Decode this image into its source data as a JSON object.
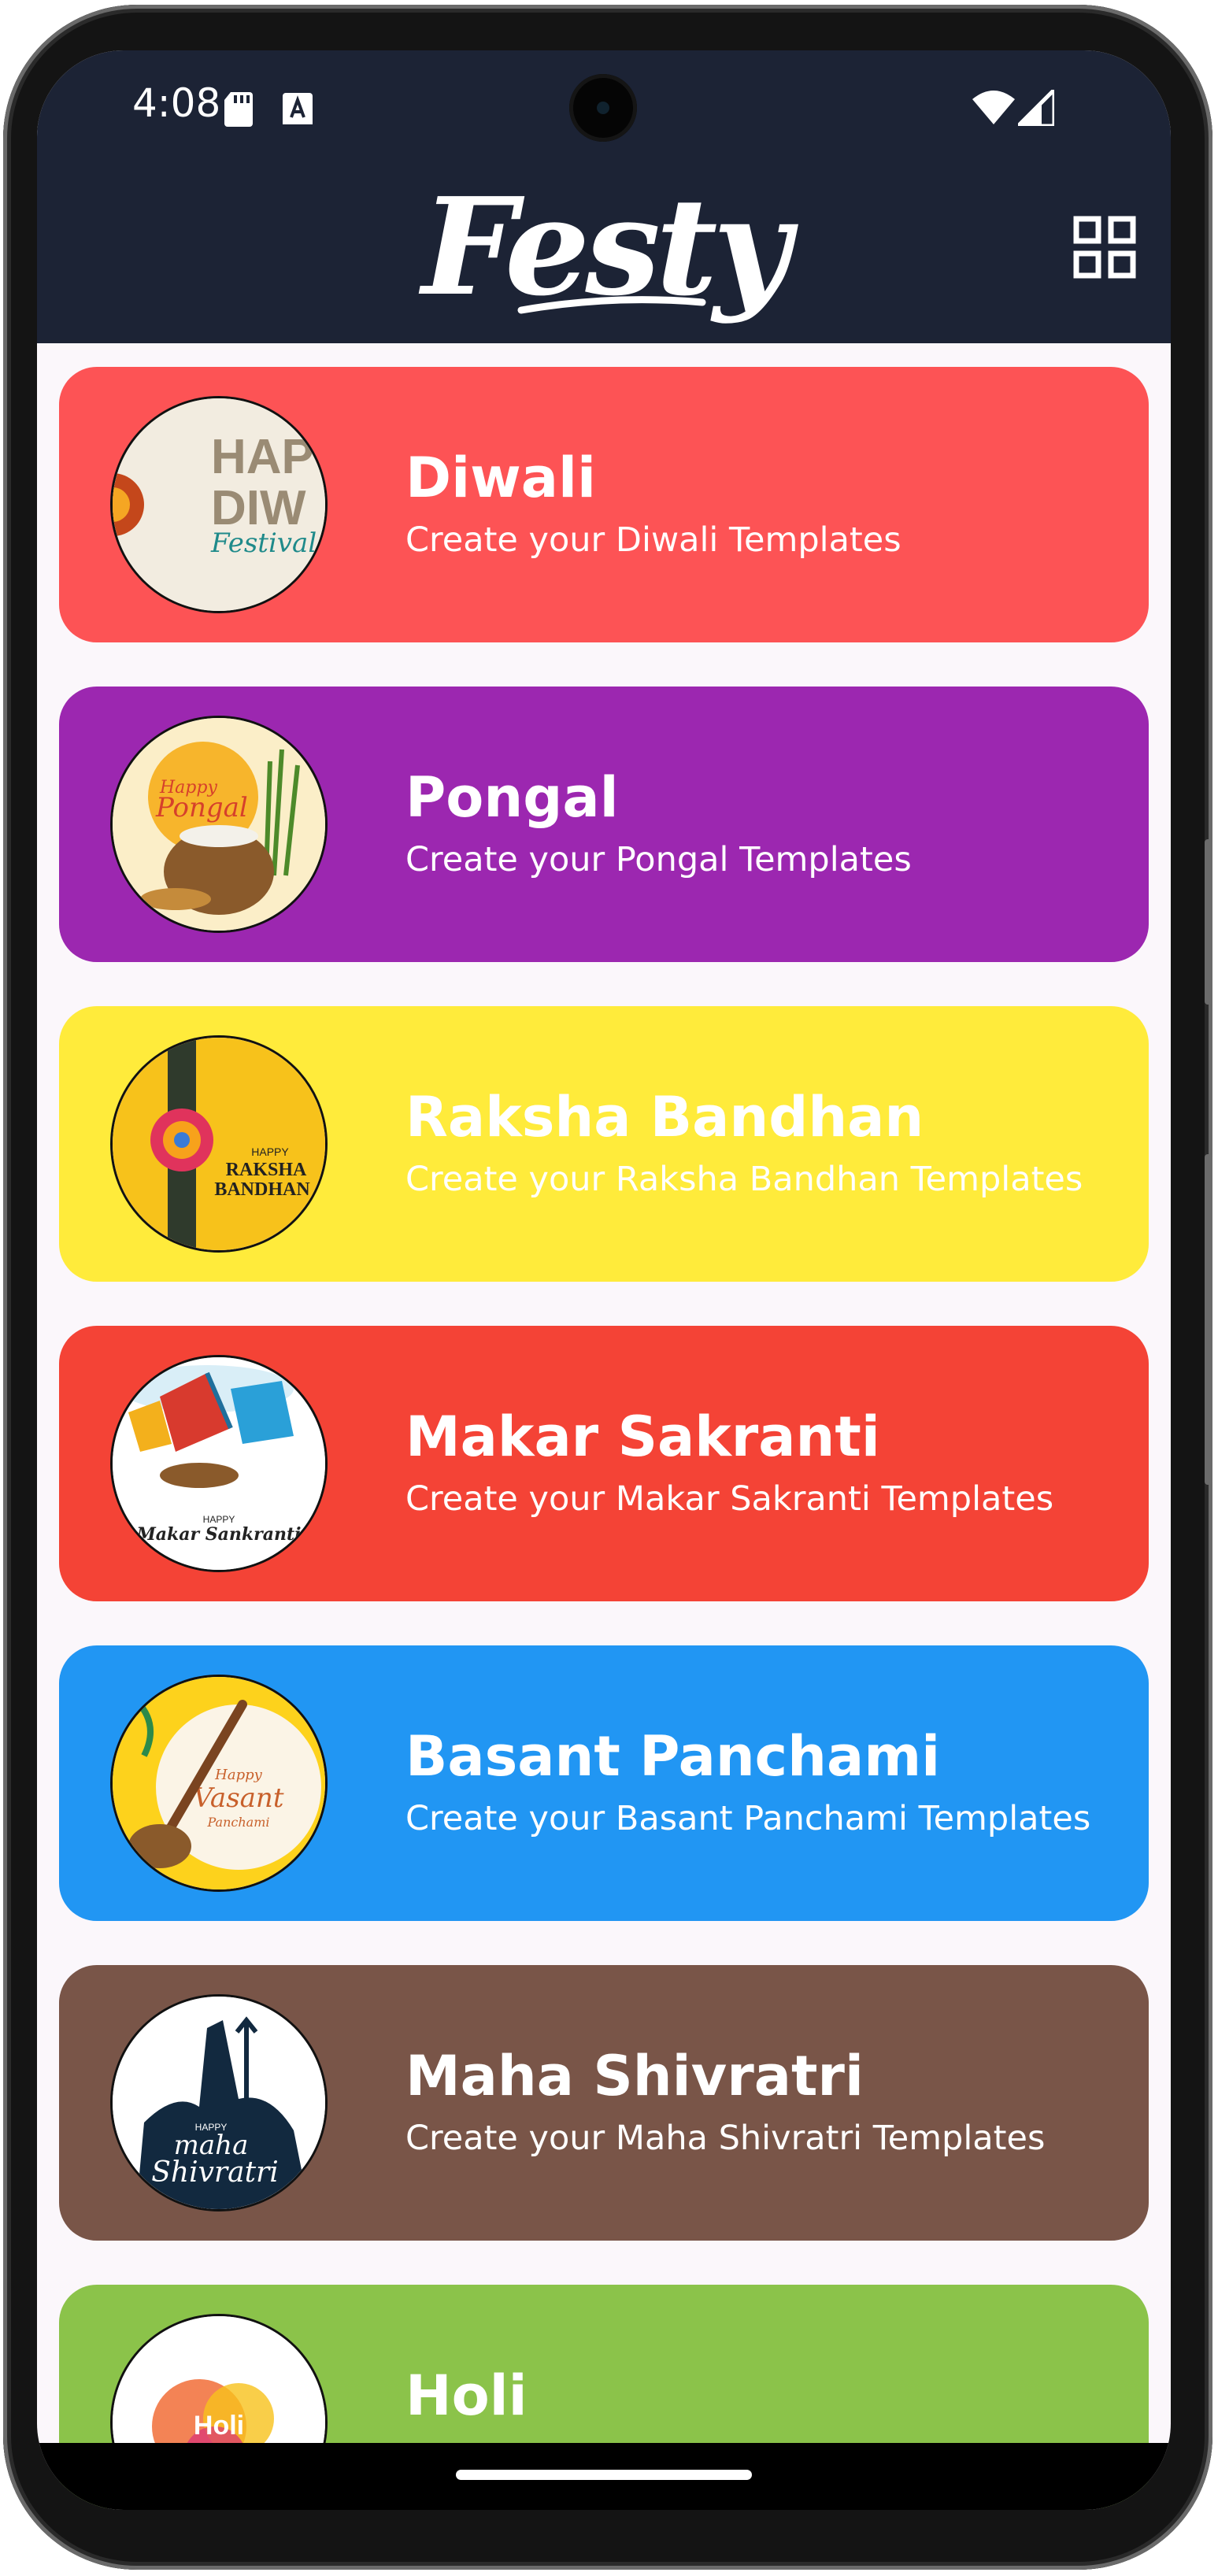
{
  "status_bar": {
    "time": "4:08",
    "icons": [
      "sd-card-icon",
      "a-badge-icon",
      "wifi-icon",
      "signal-icon"
    ]
  },
  "app_bar": {
    "logo_text": "Festy",
    "background": "#1c2335",
    "grid_button_icon": "grid-view-icon"
  },
  "festivals": [
    {
      "title": "Diwali",
      "subtitle": "Create your Diwali Templates",
      "color": "#fd5355",
      "thumb_text": "HAPPY DIWALI",
      "thumb_caption": "Festival of"
    },
    {
      "title": "Pongal",
      "subtitle": "Create your Pongal Templates",
      "color": "#9c27b0",
      "thumb_text": "Happy Pongal",
      "thumb_caption": ""
    },
    {
      "title": "Raksha Bandhan",
      "subtitle": "Create your Raksha Bandhan Templates",
      "color": "#ffeb3b",
      "thumb_text": "HAPPY RAKSHA BANDHAN",
      "thumb_caption": ""
    },
    {
      "title": "Makar Sakranti",
      "subtitle": "Create your Makar Sakranti Templates",
      "color": "#f44336",
      "thumb_text": "HAPPY Makar Sankranti",
      "thumb_caption": ""
    },
    {
      "title": "Basant Panchami",
      "subtitle": "Create your Basant Panchami Templates",
      "color": "#2196f3",
      "thumb_text": "Happy Vasant Panchami",
      "thumb_caption": ""
    },
    {
      "title": "Maha Shivratri",
      "subtitle": "Create your Maha Shivratri Templates",
      "color": "#795548",
      "thumb_text": "HAPPY maha Shivratri",
      "thumb_caption": ""
    },
    {
      "title": "Holi",
      "subtitle": "",
      "color": "#8bc34a",
      "thumb_text": "Happy Holi",
      "thumb_caption": ""
    }
  ]
}
